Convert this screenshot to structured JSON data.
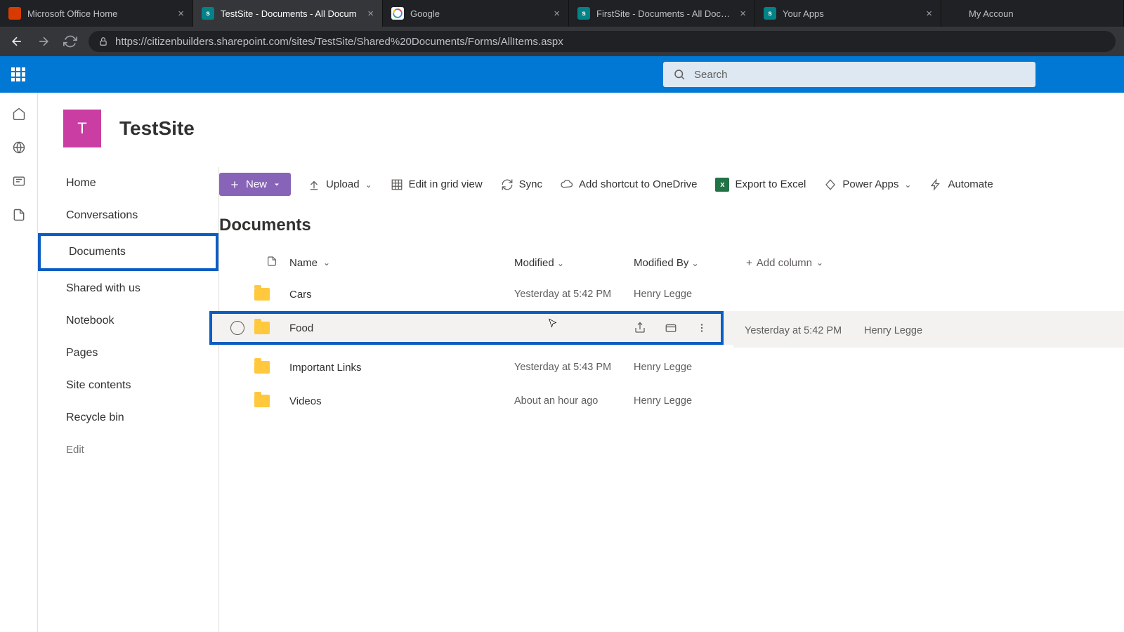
{
  "browser": {
    "tabs": [
      {
        "title": "Microsoft Office Home"
      },
      {
        "title": "TestSite - Documents - All Docum"
      },
      {
        "title": "Google"
      },
      {
        "title": "FirstSite - Documents - All Docum"
      },
      {
        "title": "Your Apps"
      },
      {
        "title": "My Accoun"
      }
    ],
    "url": "https://citizenbuilders.sharepoint.com/sites/TestSite/Shared%20Documents/Forms/AllItems.aspx"
  },
  "header": {
    "search_placeholder": "Search"
  },
  "site": {
    "logo_letter": "T",
    "name": "TestSite"
  },
  "leftnav": {
    "items": [
      "Home",
      "Conversations",
      "Documents",
      "Shared with us",
      "Notebook",
      "Pages",
      "Site contents",
      "Recycle bin"
    ],
    "edit": "Edit"
  },
  "toolbar": {
    "new": "New",
    "upload": "Upload",
    "edit_grid": "Edit in grid view",
    "sync": "Sync",
    "shortcut": "Add shortcut to OneDrive",
    "export": "Export to Excel",
    "powerapps": "Power Apps",
    "automate": "Automate"
  },
  "section": {
    "title": "Documents"
  },
  "columns": {
    "name": "Name",
    "modified": "Modified",
    "modified_by": "Modified By",
    "add": "Add column"
  },
  "rows": [
    {
      "name": "Cars",
      "modified": "Yesterday at 5:42 PM",
      "modified_by": "Henry Legge"
    },
    {
      "name": "Food",
      "modified": "Yesterday at 5:42 PM",
      "modified_by": "Henry Legge"
    },
    {
      "name": "Important Links",
      "modified": "Yesterday at 5:43 PM",
      "modified_by": "Henry Legge"
    },
    {
      "name": "Videos",
      "modified": "About an hour ago",
      "modified_by": "Henry Legge"
    }
  ]
}
